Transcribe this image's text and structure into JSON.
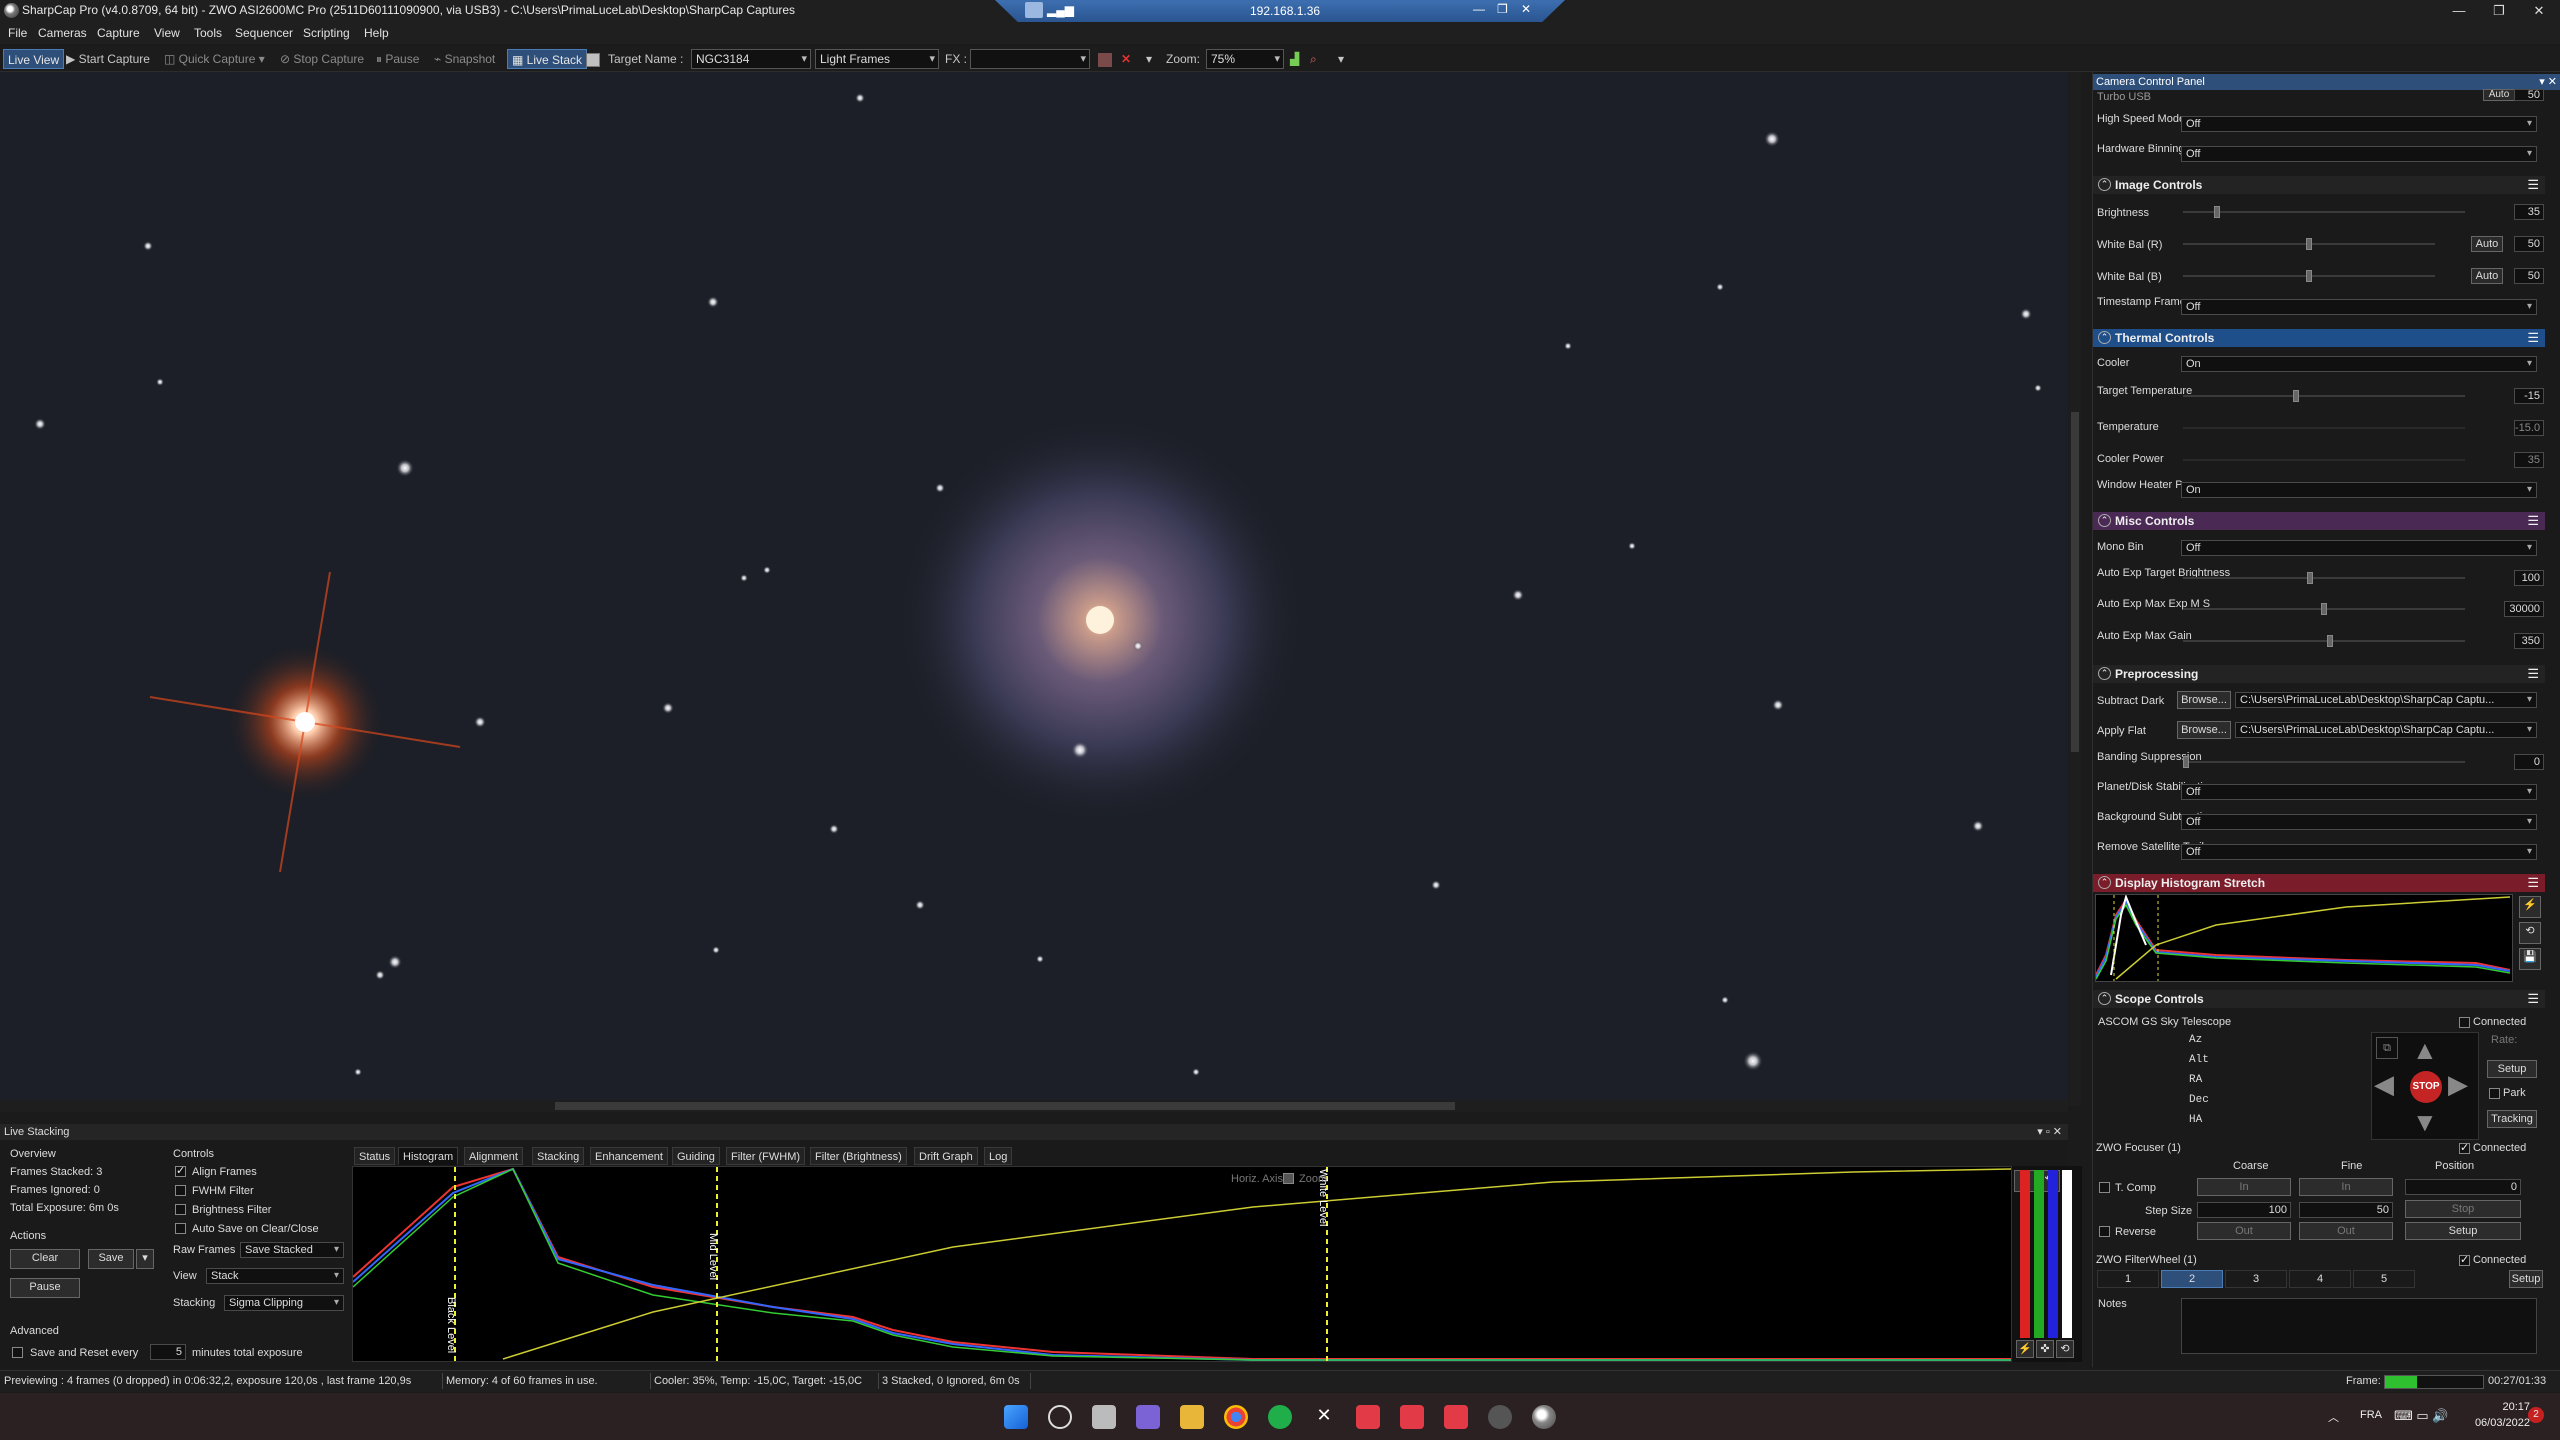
{
  "titlebar": {
    "title": "SharpCap Pro (v4.0.8709, 64 bit) - ZWO ASI2600MC Pro (2511D60111090900, via USB3) - C:\\Users\\PrimaLuceLab\\Desktop\\SharpCap Captures",
    "remote_ip": "192.168.1.36"
  },
  "menu": [
    "File",
    "Cameras",
    "Capture",
    "View",
    "Tools",
    "Sequencer",
    "Scripting",
    "Help"
  ],
  "toolbar": {
    "live_view": "Live View",
    "start_capture": "Start Capture",
    "quick_capture": "Quick Capture",
    "stop_capture": "Stop Capture",
    "pause": "Pause",
    "snapshot": "Snapshot",
    "live_stack": "Live Stack",
    "target_label": "Target Name :",
    "target_value": "NGC3184",
    "frame_type": "Light Frames",
    "fx_label": "FX :",
    "fx_value": "",
    "zoom_label": "Zoom:",
    "zoom_value": "75%"
  },
  "ccp": {
    "title": "Camera Control Panel",
    "turbo": "Turbo USB",
    "turbo_auto": "Auto",
    "turbo_val": "50",
    "high_speed_label": "High Speed Mode",
    "high_speed_val": "Off",
    "hw_binning_label": "Hardware Binning",
    "hw_binning_val": "Off",
    "image_controls": "Image Controls",
    "brightness_label": "Brightness",
    "brightness_val": "35",
    "brightness_frac": 0.12,
    "wb_r_label": "White Bal (R)",
    "wb_r_auto": "Auto",
    "wb_r_val": "50",
    "wb_r_frac": 0.5,
    "wb_b_label": "White Bal (B)",
    "wb_b_auto": "Auto",
    "wb_b_val": "50",
    "wb_b_frac": 0.5,
    "timestamp_label": "Timestamp Frames",
    "timestamp_val": "Off",
    "thermal_controls": "Thermal Controls",
    "cooler_label": "Cooler",
    "cooler_val": "On",
    "target_temp_label": "Target Temperature",
    "target_temp_val": "-15",
    "target_temp_frac": 0.4,
    "temperature_label": "Temperature",
    "temperature_val": "-15.0",
    "cooler_power_label": "Cooler Power",
    "cooler_power_val": "35",
    "window_heater_label": "Window Heater Power",
    "window_heater_val": "On",
    "misc_controls": "Misc Controls",
    "mono_bin_label": "Mono Bin",
    "mono_bin_val": "Off",
    "ae_target_label": "Auto Exp Target Brightness",
    "ae_target_val": "100",
    "ae_target_frac": 0.45,
    "ae_max_label": "Auto Exp Max Exp M S",
    "ae_max_val": "30000",
    "ae_max_frac": 0.5,
    "ae_gain_label": "Auto Exp Max Gain",
    "ae_gain_val": "350",
    "ae_gain_frac": 0.52,
    "preprocessing": "Preprocessing",
    "subtract_dark_label": "Subtract Dark",
    "browse": "Browse...",
    "subtract_dark_path": "C:\\Users\\PrimaLuceLab\\Desktop\\SharpCap Captu...",
    "apply_flat_label": "Apply Flat",
    "apply_flat_path": "C:\\Users\\PrimaLuceLab\\Desktop\\SharpCap Captu...",
    "banding_label": "Banding Suppression",
    "banding_val": "0",
    "planet_label": "Planet/Disk Stabilization",
    "planet_val": "Off",
    "bg_sub_label": "Background Subtraction",
    "bg_sub_val": "Off",
    "sat_label": "Remove Satellite Trails",
    "sat_val": "Off",
    "display_stretch": "Display Histogram Stretch",
    "scope_controls": "Scope Controls",
    "scope_name": "ASCOM GS Sky Telescope",
    "connected": "Connected",
    "axes": [
      "Az",
      "Alt",
      "RA",
      "Dec",
      "HA"
    ],
    "rate": "Rate:",
    "setup": "Setup",
    "park": "Park",
    "tracking": "Tracking",
    "stop": "STOP",
    "focuser_name": "ZWO Focuser (1)",
    "coarse": "Coarse",
    "fine": "Fine",
    "position": "Position",
    "tcomp": "T. Comp",
    "in": "In",
    "pos_val": "0",
    "step_size": "Step Size",
    "coarse_step": "100",
    "fine_step": "50",
    "stop_btn": "Stop",
    "reverse": "Reverse",
    "out": "Out",
    "fw_name": "ZWO FilterWheel (1)",
    "fw_slots": [
      "1",
      "2",
      "3",
      "4",
      "5"
    ],
    "notes": "Notes"
  },
  "ls": {
    "title": "Live Stacking",
    "overview": "Overview",
    "frames_stacked": "Frames Stacked: 3",
    "frames_ignored": "Frames Ignored: 0",
    "total_exposure": "Total Exposure:  6m 0s",
    "actions": "Actions",
    "clear": "Clear",
    "save": "Save",
    "pause": "Pause",
    "advanced": "Advanced",
    "save_reset": "Save and Reset every",
    "save_reset_val": "5",
    "minutes": "minutes total exposure",
    "controls": "Controls",
    "align": "Align Frames",
    "fwhm": "FWHM Filter",
    "bright": "Brightness Filter",
    "autosave": "Auto Save on Clear/Close",
    "raw_label": "Raw Frames",
    "raw_val": "Save Stacked",
    "view_label": "View",
    "view_val": "Stack",
    "stacking_label": "Stacking",
    "stacking_val": "Sigma Clipping",
    "tabs": [
      "Status",
      "Histogram",
      "Alignment",
      "Stacking",
      "Enhancement",
      "Guiding",
      "Filter (FWHM)",
      "Filter (Brightness)",
      "Drift Graph",
      "Log"
    ],
    "horiz_axis": "Horiz. Axis:",
    "zoom": "Zoom",
    "black_level": "Black Level",
    "mid_level": "Mid Level",
    "white_level": "White Level"
  },
  "status": {
    "preview": "Previewing : 4 frames (0 dropped) in 0:06:32,2, exposure 120,0s , last frame 120,9s",
    "memory": "Memory: 4 of 60 frames in use.",
    "cooler": "Cooler: 35%, Temp: -15,0C, Target: -15,0C",
    "stacked": "3 Stacked, 0 Ignored, 6m 0s",
    "frame_label": "Frame:",
    "frame_progress": 0.33,
    "elapsed": "00:27/01:33"
  },
  "taskbar": {
    "lang": "FRA",
    "time": "20:17",
    "date": "06/03/2022",
    "notif": "2"
  },
  "colors": {
    "accent": "#2d4f7a",
    "thermal": "#1f4f8a",
    "misc": "#4a2a55",
    "stretch": "#7a1c2a"
  }
}
